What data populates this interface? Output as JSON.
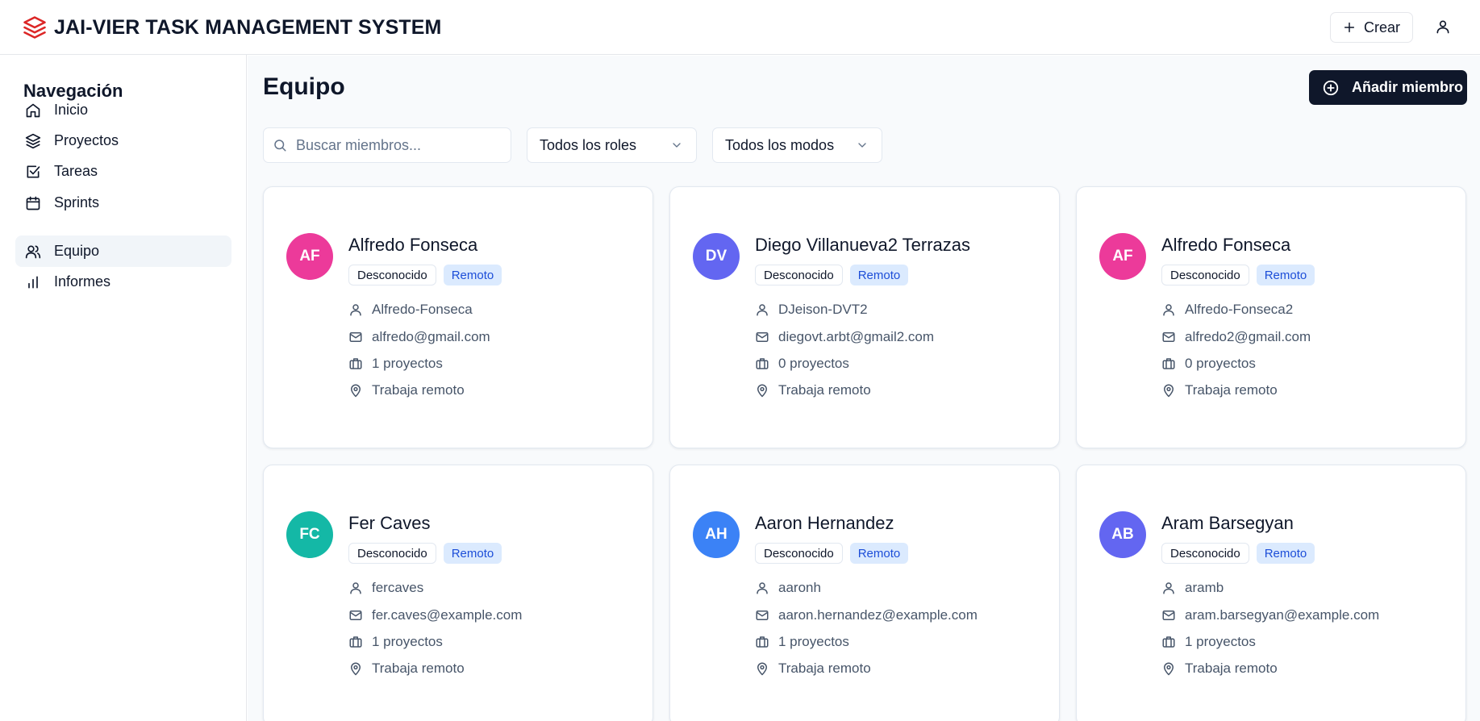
{
  "app": {
    "title": "JAI-VIER TASK MANAGEMENT SYSTEM",
    "create_label": "Crear",
    "brand_color": "#dc2626"
  },
  "sidebar": {
    "title": "Navegación",
    "items": [
      {
        "label": "Inicio",
        "icon": "home-icon"
      },
      {
        "label": "Proyectos",
        "icon": "layers-icon"
      },
      {
        "label": "Tareas",
        "icon": "checkbox-icon"
      },
      {
        "label": "Sprints",
        "icon": "calendar-icon"
      },
      {
        "label": "Equipo",
        "icon": "users-icon",
        "active": true
      },
      {
        "label": "Informes",
        "icon": "bar-chart-icon"
      }
    ]
  },
  "main": {
    "title": "Equipo",
    "add_button_label": "Añadir miembro",
    "search_placeholder": "Buscar miembros...",
    "role_filter": "Todos los roles",
    "mode_filter": "Todos los modos"
  },
  "members": [
    {
      "initials": "AF",
      "name": "Alfredo Fonseca",
      "status": "Desconocido",
      "mode": "Remoto",
      "username": "Alfredo-Fonseca",
      "email": "alfredo@gmail.com",
      "projects": "1 proyectos",
      "location": "Trabaja remoto",
      "color": "#ec3a9a"
    },
    {
      "initials": "DV",
      "name": "Diego Villanueva2 Terrazas",
      "status": "Desconocido",
      "mode": "Remoto",
      "username": "DJeison-DVT2",
      "email": "diegovt.arbt@gmail2.com",
      "projects": "0 proyectos",
      "location": "Trabaja remoto",
      "color": "#6366f1"
    },
    {
      "initials": "AF",
      "name": "Alfredo Fonseca",
      "status": "Desconocido",
      "mode": "Remoto",
      "username": "Alfredo-Fonseca2",
      "email": "alfredo2@gmail.com",
      "projects": "0 proyectos",
      "location": "Trabaja remoto",
      "color": "#ec3a9a"
    },
    {
      "initials": "FC",
      "name": "Fer Caves",
      "status": "Desconocido",
      "mode": "Remoto",
      "username": "fercaves",
      "email": "fer.caves@example.com",
      "projects": "1 proyectos",
      "location": "Trabaja remoto",
      "color": "#14b8a6"
    },
    {
      "initials": "AH",
      "name": "Aaron Hernandez",
      "status": "Desconocido",
      "mode": "Remoto",
      "username": "aaronh",
      "email": "aaron.hernandez@example.com",
      "projects": "1 proyectos",
      "location": "Trabaja remoto",
      "color": "#3b82f6"
    },
    {
      "initials": "AB",
      "name": "Aram Barsegyan",
      "status": "Desconocido",
      "mode": "Remoto",
      "username": "aramb",
      "email": "aram.barsegyan@example.com",
      "projects": "1 proyectos",
      "location": "Trabaja remoto",
      "color": "#6366f1"
    }
  ]
}
